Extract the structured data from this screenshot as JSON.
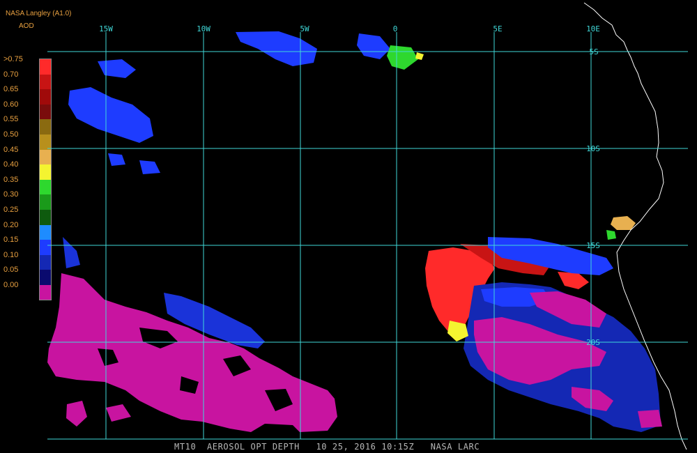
{
  "header": {
    "source": "NASA Langley (A1.0)",
    "product": "AOD"
  },
  "legend": {
    "items": [
      {
        "label": ">0.75",
        "color": "#ff2a2a"
      },
      {
        "label": "0.70",
        "color": "#c81414"
      },
      {
        "label": "0.65",
        "color": "#a00a0a"
      },
      {
        "label": "0.60",
        "color": "#7a0c0c"
      },
      {
        "label": "0.55",
        "color": "#8a6a10"
      },
      {
        "label": "0.50",
        "color": "#b8901c"
      },
      {
        "label": "0.45",
        "color": "#e8b050"
      },
      {
        "label": "0.40",
        "color": "#f4f430"
      },
      {
        "label": "0.35",
        "color": "#2ed82e"
      },
      {
        "label": "0.30",
        "color": "#1a9a1a"
      },
      {
        "label": "0.25",
        "color": "#0e5a0e"
      },
      {
        "label": "0.20",
        "color": "#1e8cff"
      },
      {
        "label": "0.15",
        "color": "#1e3cff"
      },
      {
        "label": "0.10",
        "color": "#1428b4"
      },
      {
        "label": "0.05",
        "color": "#0a0a6e"
      },
      {
        "label": "0.00",
        "color": "#c814a0"
      }
    ]
  },
  "axes": {
    "longitude_labels": [
      "15W",
      "10W",
      "5W",
      "0",
      "5E",
      "10E"
    ],
    "latitude_labels": [
      "5S",
      "10S",
      "15S",
      "20S"
    ]
  },
  "footer": {
    "caption": "MT10  AEROSOL OPT DEPTH   10 25, 2016 10:15Z   NASA LARC"
  },
  "colors": {
    "grid": "#40d8d8",
    "coastline": "#ffffff",
    "background": "#000000",
    "label_orange": "#e8a040",
    "footer_text": "#b8b8b8"
  }
}
